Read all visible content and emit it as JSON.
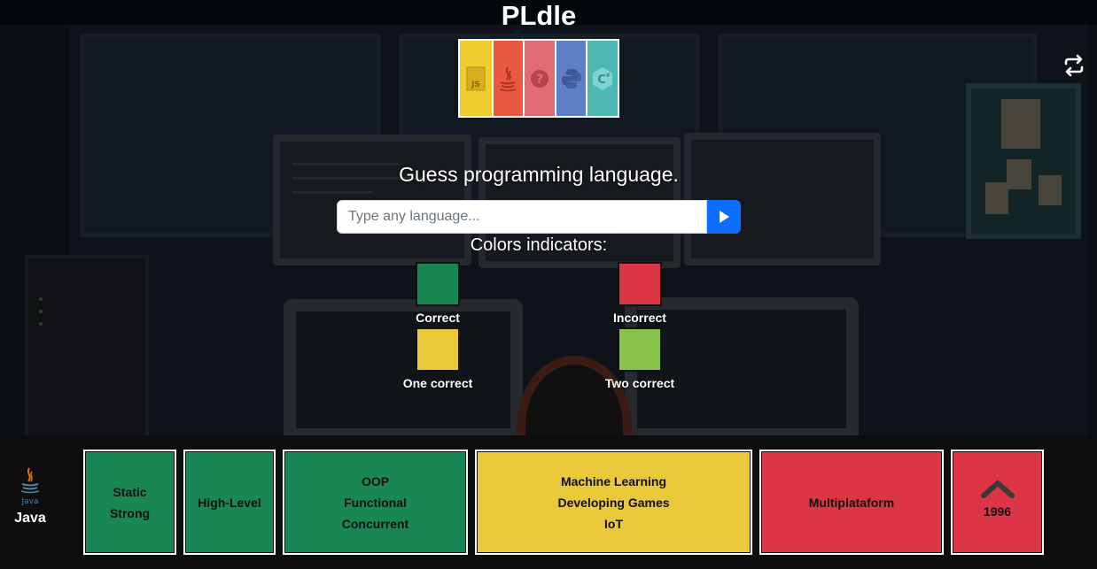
{
  "title": "PLdle",
  "prompt": "Guess programming language.",
  "search": {
    "placeholder": "Type any language..."
  },
  "legend": {
    "title": "Colors indicators:",
    "items": [
      {
        "label": "Correct",
        "color": "#198754"
      },
      {
        "label": "Incorrect",
        "color": "#dc3545"
      },
      {
        "label": "One correct",
        "color": "#e9c83a"
      },
      {
        "label": "Two correct",
        "color": "#8bc34a"
      }
    ]
  },
  "logo_tiles": [
    {
      "icon": "javascript-icon",
      "icon_text": "JS",
      "color": "#f0cd2f"
    },
    {
      "icon": "java-icon",
      "color": "#e8593f"
    },
    {
      "icon": "question-icon",
      "color": "#e06c75"
    },
    {
      "icon": "python-icon",
      "color": "#5e7ec6"
    },
    {
      "icon": "c-sharp-icon",
      "color": "#4fb8b4"
    }
  ],
  "guess": {
    "language": "Java",
    "logo_text": "Java",
    "cells": [
      {
        "lines": [
          "Static",
          "Strong"
        ],
        "status": "correct",
        "color": "#198754"
      },
      {
        "lines": [
          "High-Level"
        ],
        "status": "correct",
        "color": "#198754"
      },
      {
        "lines": [
          "OOP",
          "Functional",
          "Concurrent"
        ],
        "status": "correct",
        "color": "#198754"
      },
      {
        "lines": [
          "Machine Learning",
          "Developing Games",
          "IoT"
        ],
        "status": "one-correct",
        "color": "#e9c83a"
      },
      {
        "lines": [
          "Multiplataform"
        ],
        "status": "incorrect",
        "color": "#dc3545"
      },
      {
        "lines": [
          "1996"
        ],
        "status": "incorrect",
        "color": "#dc3545",
        "arrow": "up"
      }
    ]
  }
}
